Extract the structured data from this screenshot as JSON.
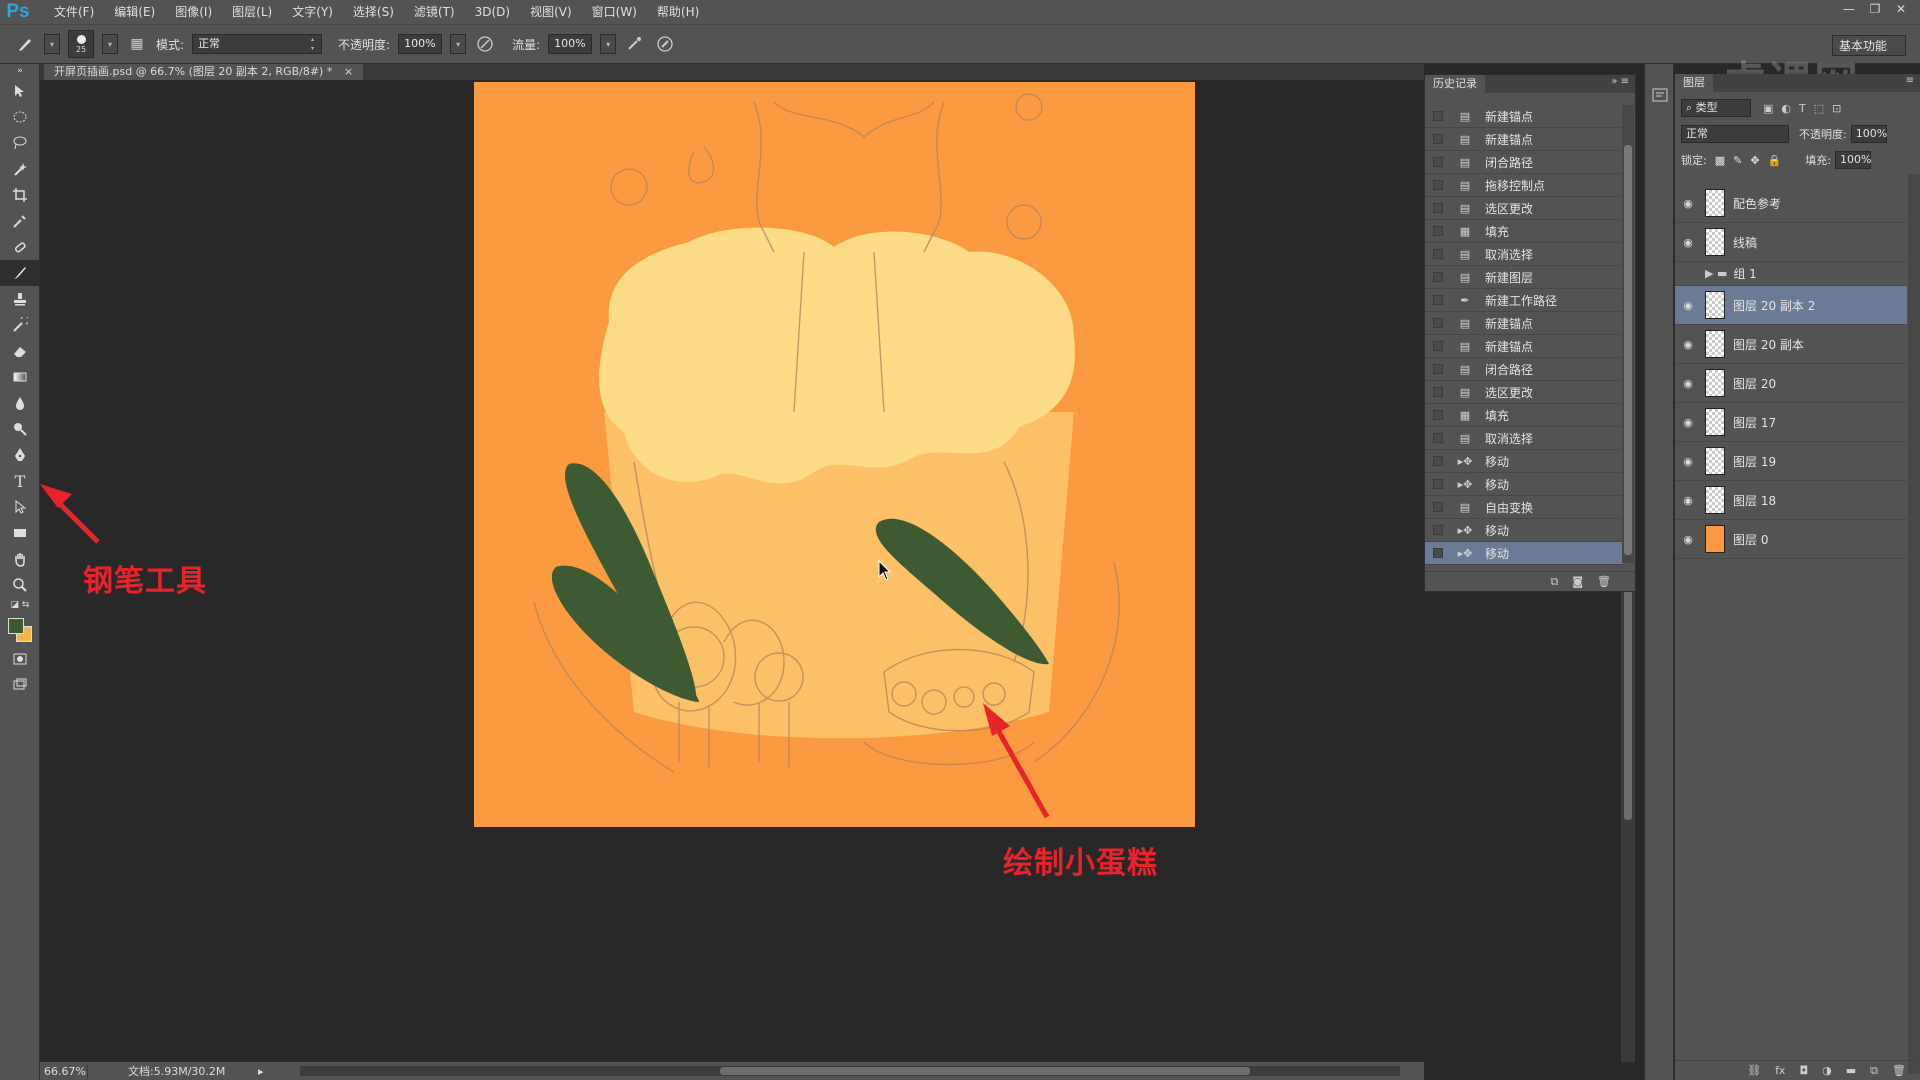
{
  "app": {
    "logo": "Ps",
    "menus": [
      "文件(F)",
      "编辑(E)",
      "图像(I)",
      "图层(L)",
      "文字(Y)",
      "选择(S)",
      "滤镜(T)",
      "3D(D)",
      "视图(V)",
      "窗口(W)",
      "帮助(H)"
    ],
    "window_buttons": [
      "—",
      "❐",
      "✕"
    ],
    "workspace": "基本功能",
    "watermark": "虎课网"
  },
  "options_bar": {
    "brush_size": "25",
    "mode_label": "模式:",
    "mode_value": "正常",
    "opacity_label": "不透明度:",
    "opacity_value": "100%",
    "flow_label": "流量:",
    "flow_value": "100%"
  },
  "document": {
    "tab_title": "开屏页插画.psd @ 66.7% (图层 20 副本 2, RGB/8#) *",
    "zoom": "66.67%",
    "doc_info": "文档:5.93M/30.2M"
  },
  "annotations": {
    "pen_tool": "钢笔工具",
    "draw_cake": "绘制小蛋糕"
  },
  "history": {
    "tab": "历史记录",
    "items": [
      {
        "icon": "doc",
        "label": "新建锚点"
      },
      {
        "icon": "doc",
        "label": "新建锚点"
      },
      {
        "icon": "doc",
        "label": "闭合路径"
      },
      {
        "icon": "doc",
        "label": "拖移控制点"
      },
      {
        "icon": "doc",
        "label": "选区更改"
      },
      {
        "icon": "fill",
        "label": "填充"
      },
      {
        "icon": "doc",
        "label": "取消选择"
      },
      {
        "icon": "doc",
        "label": "新建图层"
      },
      {
        "icon": "pen",
        "label": "新建工作路径"
      },
      {
        "icon": "doc",
        "label": "新建锚点"
      },
      {
        "icon": "doc",
        "label": "新建锚点"
      },
      {
        "icon": "doc",
        "label": "闭合路径"
      },
      {
        "icon": "doc",
        "label": "选区更改"
      },
      {
        "icon": "fill",
        "label": "填充"
      },
      {
        "icon": "doc",
        "label": "取消选择"
      },
      {
        "icon": "move",
        "label": "移动"
      },
      {
        "icon": "move",
        "label": "移动"
      },
      {
        "icon": "doc",
        "label": "自由变换"
      },
      {
        "icon": "move",
        "label": "移动"
      },
      {
        "icon": "move",
        "label": "移动"
      }
    ],
    "selected_index": 19
  },
  "layers": {
    "tab": "图层",
    "filter": "类型",
    "blend_mode": "正常",
    "opacity_label": "不透明度:",
    "opacity_value": "100%",
    "lock_label": "锁定:",
    "fill_label": "填充:",
    "fill_value": "100%",
    "items": [
      {
        "name": "配色参考",
        "visible": true,
        "type": "layer"
      },
      {
        "name": "线稿",
        "visible": true,
        "type": "layer"
      },
      {
        "name": "组 1",
        "visible": false,
        "type": "group"
      },
      {
        "name": "图层 20 副本 2",
        "visible": true,
        "type": "layer",
        "selected": true
      },
      {
        "name": "图层 20 副本",
        "visible": true,
        "type": "layer"
      },
      {
        "name": "图层 20",
        "visible": true,
        "type": "layer"
      },
      {
        "name": "图层 17",
        "visible": true,
        "type": "layer"
      },
      {
        "name": "图层 19",
        "visible": true,
        "type": "layer"
      },
      {
        "name": "图层 18",
        "visible": true,
        "type": "layer"
      },
      {
        "name": "图层 0",
        "visible": true,
        "type": "layer",
        "thumb": "orange"
      }
    ]
  },
  "colors": {
    "canvas_bg": "#fb9a40",
    "leaf_green": "#3d5a32",
    "cake_light": "#fde08a",
    "foreground": "#3d5a32",
    "background": "#f5b44a",
    "annotation_red": "#e8232a",
    "selection": "#6b7a96"
  }
}
